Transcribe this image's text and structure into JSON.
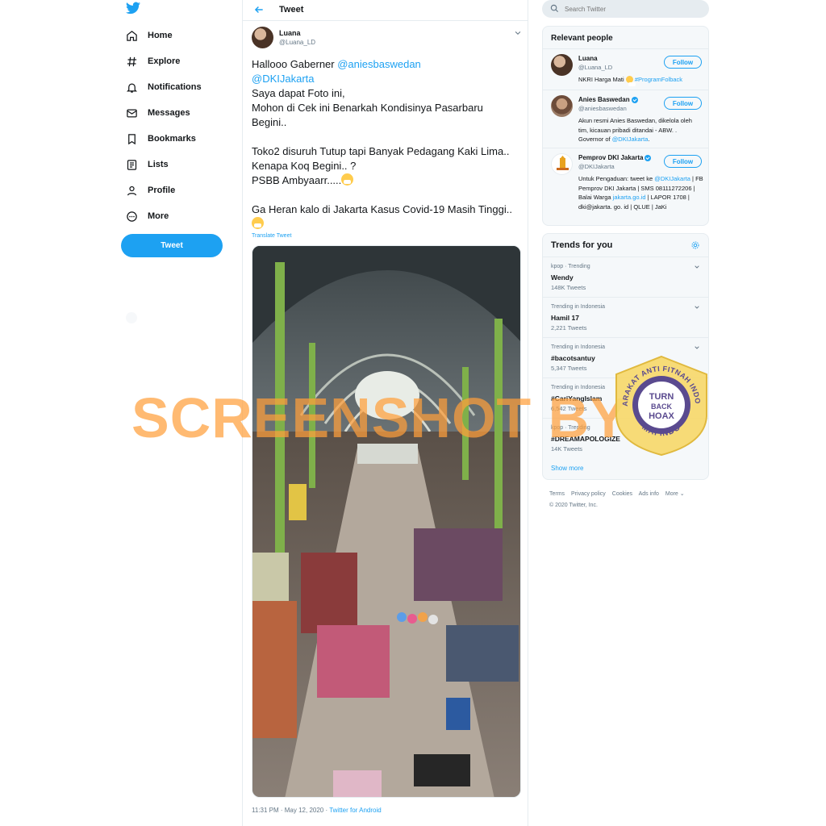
{
  "nav": {
    "items": [
      {
        "label": "Home",
        "icon": "home-icon"
      },
      {
        "label": "Explore",
        "icon": "hashtag-icon"
      },
      {
        "label": "Notifications",
        "icon": "bell-icon"
      },
      {
        "label": "Messages",
        "icon": "envelope-icon"
      },
      {
        "label": "Bookmarks",
        "icon": "bookmark-icon"
      },
      {
        "label": "Lists",
        "icon": "list-icon"
      },
      {
        "label": "Profile",
        "icon": "user-icon"
      },
      {
        "label": "More",
        "icon": "more-circle-icon"
      }
    ],
    "tweet_button": "Tweet"
  },
  "main": {
    "header_title": "Tweet",
    "author_name": "Luana",
    "author_handle": "@Luana_LD",
    "text": {
      "greeting": "Hallooo Gaberner ",
      "mention1": "@aniesbaswedan",
      "mention2": "@DKIJakarta",
      "line3": "Saya dapat Foto ini,",
      "line4": "Mohon di Cek ini Benarkah Kondisinya Pasarbaru",
      "line5": "Begini..",
      "line6": "Toko2 disuruh Tutup tapi Banyak Pedagang Kaki Lima..",
      "line7": "Kenapa Koq Begini.. ?",
      "line8": "PSBB Ambyaarr.....",
      "line9": "Ga Heran kalo di Jakarta Kasus Covid-19 Masih Tinggi.."
    },
    "translate": "Translate Tweet",
    "timestamp": "11:31 PM · May 12, 2020 · ",
    "source": "Twitter for Android"
  },
  "right": {
    "search_placeholder": "Search Twitter",
    "relevant_title": "Relevant people",
    "people": [
      {
        "name": "Luana",
        "handle": "@Luana_LD",
        "follow": "Follow",
        "bio_a": "NKRI Harga Mati ",
        "bio_b": " #ProgramFolback",
        "verified": false
      },
      {
        "name": "Anies Baswedan",
        "handle": "@aniesbaswedan",
        "follow": "Follow",
        "bio_a": "Akun resmi Anies Baswedan, dikelola oleh tim, kicauan pribadi ditandai - ABW. . Governor of ",
        "bio_b": "@DKIJakarta",
        "bio_c": ".",
        "verified": true
      },
      {
        "name": "Pemprov DKI Jakarta",
        "handle": "@DKIJakarta",
        "follow": "Follow",
        "bio_a": "Untuk Pengaduan: tweet ke ",
        "bio_b": "@DKIJakarta",
        "bio_c": " | FB Pemprov DKI Jakarta | SMS 08111272206 | Balai Warga ",
        "bio_d": "jakarta.go.id",
        "bio_e": " | LAPOR 1708 | dki@jakarta. go. id | QLUE | JaKi",
        "verified": true
      }
    ],
    "trends_title": "Trends for you",
    "trends": [
      {
        "context": "kpop · Trending",
        "name": "Wendy",
        "count": "148K Tweets"
      },
      {
        "context": "Trending in Indonesia",
        "name": "Hamil 17",
        "count": "2,221 Tweets"
      },
      {
        "context": "Trending in Indonesia",
        "name": "#bacotsantuy",
        "count": "5,347 Tweets"
      },
      {
        "context": "Trending in Indonesia",
        "name": "#CariYangIslam",
        "count": "6,542 Tweets"
      },
      {
        "context": "kpop · Trending",
        "name": "#DREAMAPOLOGIZE",
        "count": "14K Tweets"
      }
    ],
    "show_more": "Show more",
    "footer": [
      "Terms",
      "Privacy policy",
      "Cookies",
      "Ads info",
      "More ⌄",
      "© 2020 Twitter, Inc."
    ]
  },
  "overlays": {
    "watermark": "SCREENSHOT BY",
    "badge_top": "MASYARAKAT ANTI FITNAH INDONESIA",
    "badge_center": [
      "TURN",
      "BACK",
      "HOAX"
    ],
    "badge_bottom": "MAFINDO"
  },
  "colors": {
    "accent": "#1da1f2",
    "text": "#14171a",
    "muted": "#657786",
    "border": "#e6ecf0",
    "badge": "#f6d86b"
  }
}
